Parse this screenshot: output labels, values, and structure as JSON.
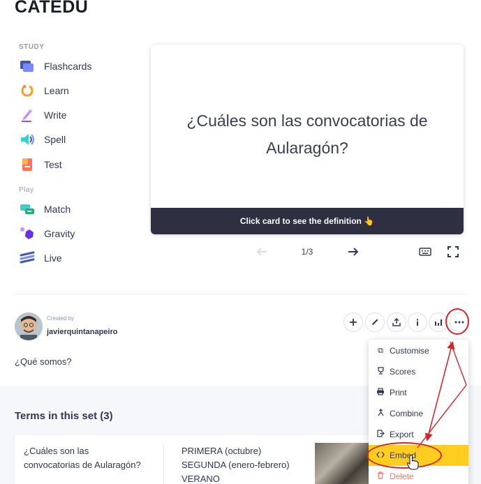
{
  "header": {
    "title": "CATEDU"
  },
  "sidebar": {
    "study_label": "STUDY",
    "play_label": "Play",
    "study_items": [
      {
        "label": "Flashcards",
        "icon": "flashcards-icon"
      },
      {
        "label": "Learn",
        "icon": "learn-icon"
      },
      {
        "label": "Write",
        "icon": "write-icon"
      },
      {
        "label": "Spell",
        "icon": "spell-icon"
      },
      {
        "label": "Test",
        "icon": "test-icon"
      }
    ],
    "play_items": [
      {
        "label": "Match",
        "icon": "match-icon"
      },
      {
        "label": "Gravity",
        "icon": "gravity-icon"
      },
      {
        "label": "Live",
        "icon": "live-icon"
      }
    ]
  },
  "flashcard": {
    "term_line1": "¿Cuáles son las convocatorias de",
    "term_line2": "Aularagón?",
    "footer": "Click card to see the definition 👆",
    "counter": "1/3"
  },
  "creator": {
    "created_by_label": "Created by",
    "username": "javierquintanapeiro"
  },
  "set_description": "¿Qué somos?",
  "more_menu": {
    "items": [
      {
        "label": "Customise",
        "icon": "copy-icon"
      },
      {
        "label": "Scores",
        "icon": "trophy-icon"
      },
      {
        "label": "Print",
        "icon": "print-icon"
      },
      {
        "label": "Combine",
        "icon": "merge-icon"
      },
      {
        "label": "Export",
        "icon": "export-icon"
      },
      {
        "label": "Embed",
        "icon": "code-icon"
      },
      {
        "label": "Delete",
        "icon": "trash-icon"
      }
    ],
    "highlighted": "Embed"
  },
  "terms": {
    "heading": "Terms in this set (3)",
    "rows": [
      {
        "term_line1": "¿Cuáles son las",
        "term_line2": "convocatorias de Aularagón?",
        "def_lines": [
          "PRIMERA (octubre)",
          "SEGUNDA (enero-febrero)",
          "VERANO"
        ]
      }
    ]
  },
  "colors": {
    "highlight": "#ffcd1f",
    "annotation": "#d42426",
    "footer_bg": "#2e3042"
  }
}
